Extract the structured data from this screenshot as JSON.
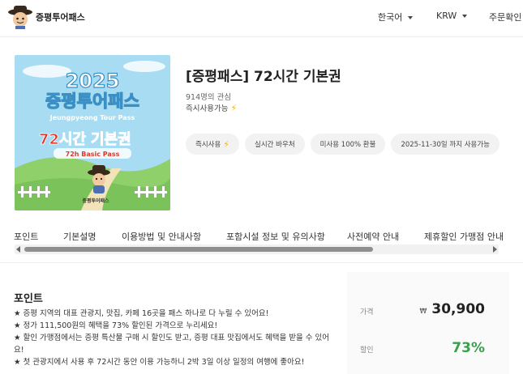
{
  "header": {
    "brand": "증평투어패스",
    "language": "한국어",
    "currency": "KRW",
    "order_check": "주문확인"
  },
  "product": {
    "image": {
      "year": "2025",
      "name": "증평투어패스",
      "english": "Jeungpyeong Tour Pass",
      "pass_title_red": "72시간",
      "pass_title_black": "기본권",
      "pass_subtitle": "72h Basic Pass",
      "badge_text": "증평투어패스"
    },
    "title": "[증평패스] 72시간 기본권",
    "views": "914명의 관심",
    "instant": "즉시사용가능",
    "tags": [
      {
        "label": "즉시사용",
        "icon": "bolt-icon"
      },
      {
        "label": "실시간 바우처"
      },
      {
        "label": "미사용 100% 환불"
      },
      {
        "label": "2025-11-30일 까지 사용가능"
      }
    ]
  },
  "tabs": [
    "포인트",
    "기본설명",
    "이용방법 및 안내사항",
    "포함시설 정보 및 유의사항",
    "사전예약 안내",
    "제휴할인 가맹점 안내"
  ],
  "points": {
    "title": "포인트",
    "items": [
      "★ 증평 지역의 대표 관광지, 맛집, 카페 16곳을 패스 하나로 다 누릴 수 있어요!",
      "★ 정가 111,500원의 혜택을 73% 할인된 가격으로 누리세요!",
      "★ 할인 가맹점에서는 증평 특산물 구매 시 할인도 받고, 증평 대표 맛집에서도 혜택을 받을 수 있어요!",
      "★ 첫 관광지에서 사용 후 72시간 동안 이용 가능하니 2박 3일 이상 일정의 여행에 좋아요!"
    ]
  },
  "price_panel": {
    "price_label": "가격",
    "currency_symbol": "₩",
    "price": "30,900",
    "discount_label": "할인",
    "discount": "73%"
  },
  "colors": {
    "discount_green": "#3aa14a",
    "bolt_yellow": "#f5b400",
    "sky_blue": "#a8dcf2",
    "grass_green": "#8fd06a",
    "pass_red": "#e2372b"
  }
}
